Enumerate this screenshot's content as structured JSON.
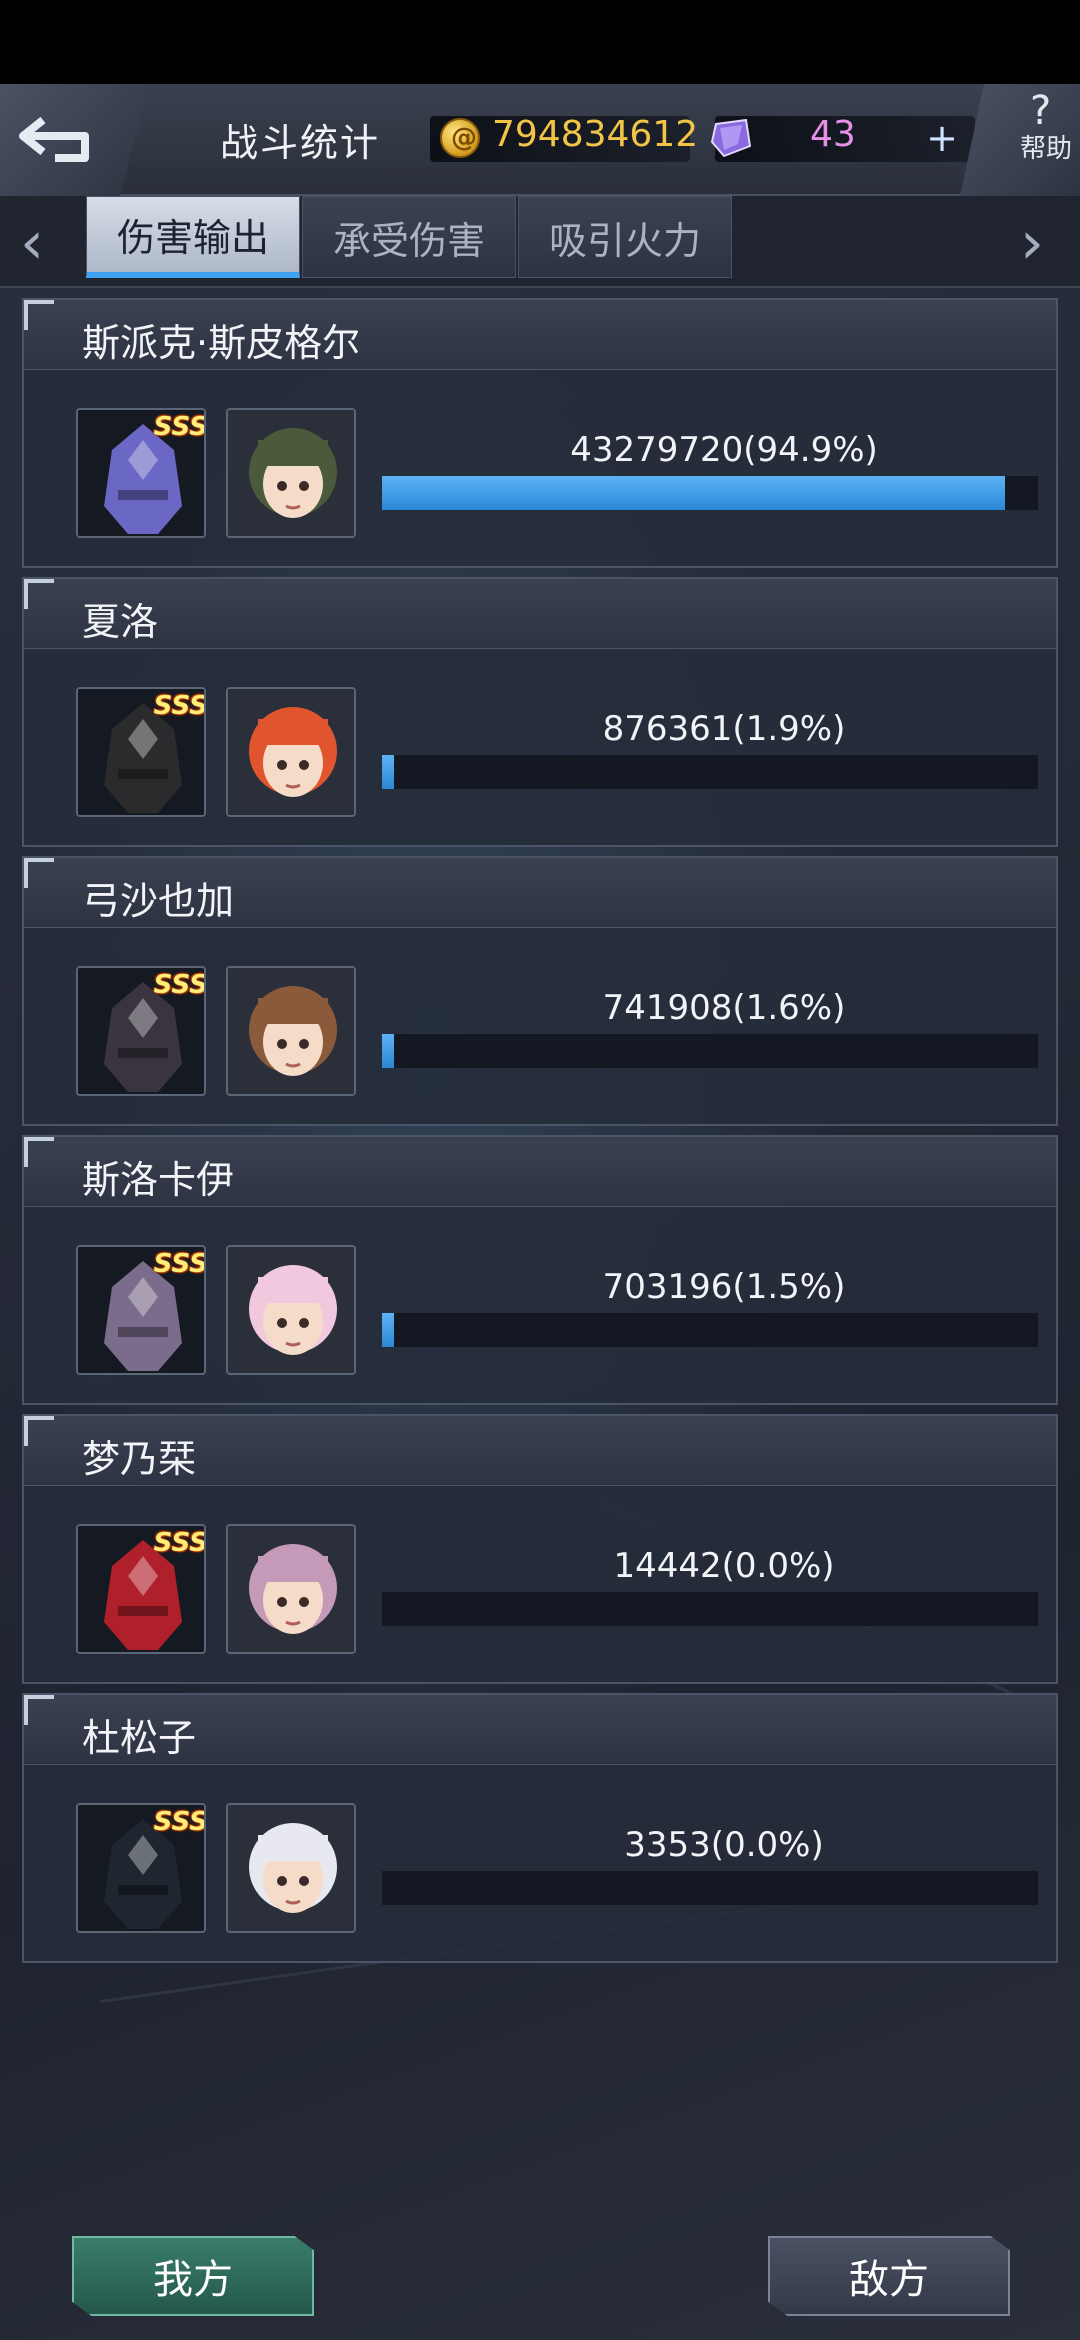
{
  "header": {
    "title": "战斗统计",
    "gold": "794834612",
    "gems": "43",
    "plus": "+",
    "help_label": "帮助",
    "help_symbol": "?"
  },
  "tabs": [
    {
      "label": "伤害输出",
      "active": true
    },
    {
      "label": "承受伤害",
      "active": false
    },
    {
      "label": "吸引火力",
      "active": false
    }
  ],
  "nav": {
    "left_arrow": "‹",
    "right_arrow": "›"
  },
  "chart_data": {
    "type": "bar",
    "title": "伤害输出",
    "categories": [
      "斯派克·斯皮格尔",
      "夏洛",
      "弓沙也加",
      "斯洛卡伊",
      "梦乃栞",
      "杜松子"
    ],
    "values": [
      43279720,
      876361,
      741908,
      703196,
      14442,
      3353
    ],
    "percent": [
      94.9,
      1.9,
      1.6,
      1.5,
      0.0,
      0.0
    ]
  },
  "pilots": [
    {
      "name": "斯派克·斯皮格尔",
      "damage_text": "43279720(94.9%)",
      "rank": "SSS",
      "mecha_color": "#6b67c4",
      "pilot_color": "#4b5a3a",
      "fraction": 0.949
    },
    {
      "name": "夏洛",
      "damage_text": "876361(1.9%)",
      "rank": "SSS",
      "mecha_color": "#2b2b2e",
      "pilot_color": "#e0552e",
      "fraction": 0.019
    },
    {
      "name": "弓沙也加",
      "damage_text": "741908(1.6%)",
      "rank": "SSS",
      "mecha_color": "#3a3340",
      "pilot_color": "#8a5a3a",
      "fraction": 0.016
    },
    {
      "name": "斯洛卡伊",
      "damage_text": "703196(1.5%)",
      "rank": "SSS",
      "mecha_color": "#7a6c8a",
      "pilot_color": "#f2c8df",
      "fraction": 0.015
    },
    {
      "name": "梦乃栞",
      "damage_text": "14442(0.0%)",
      "rank": "SSS",
      "mecha_color": "#b0202a",
      "pilot_color": "#c59ab8",
      "fraction": 0.0
    },
    {
      "name": "杜松子",
      "damage_text": "3353(0.0%)",
      "rank": "SSS",
      "mecha_color": "#1e2630",
      "pilot_color": "#e8e8f0",
      "fraction": 0.0
    }
  ],
  "bottom": {
    "mine_label": "我方",
    "enemy_label": "敌方"
  }
}
